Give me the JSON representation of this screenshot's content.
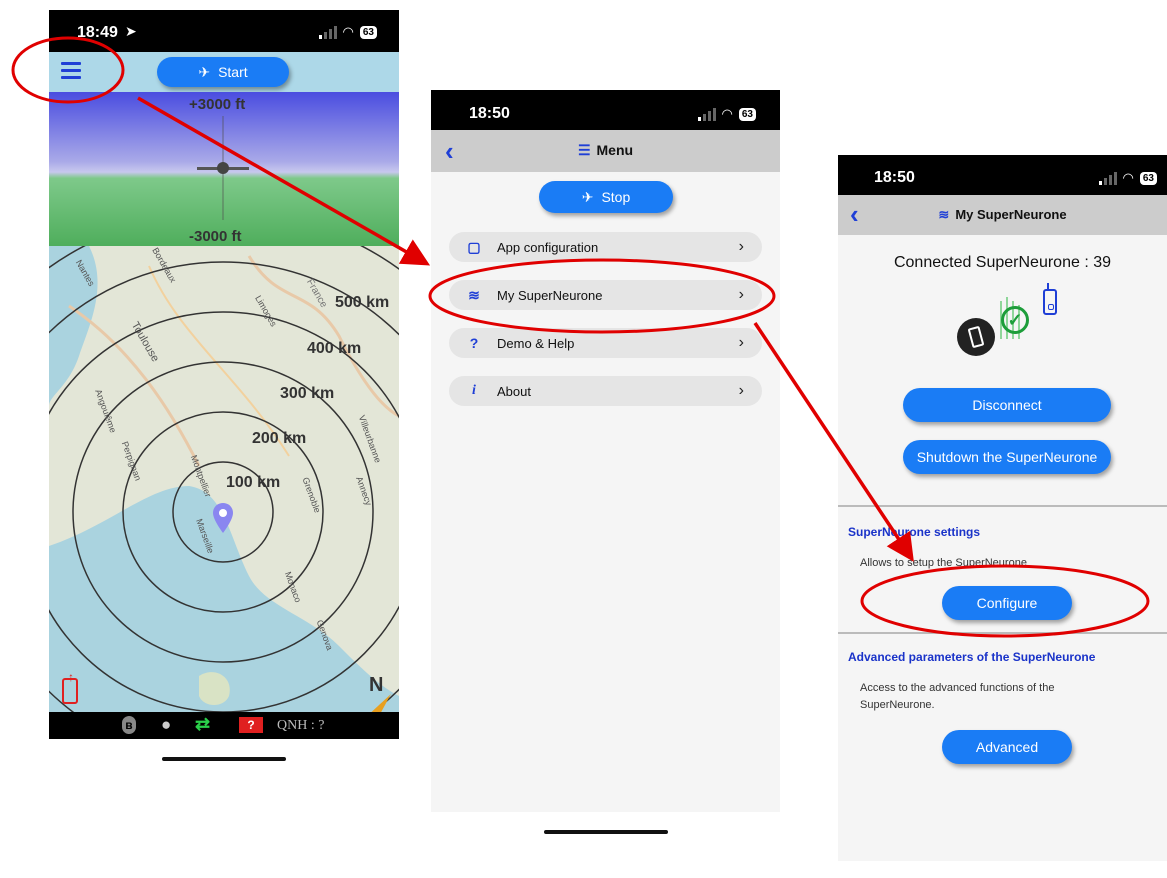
{
  "phone1": {
    "status_time": "18:49",
    "battery": "63",
    "start_label": "Start",
    "altitude_top": "+3000 ft",
    "altitude_bottom": "-3000 ft",
    "ring_labels": [
      "500 km",
      "400 km",
      "300 km",
      "200 km",
      "100 km"
    ],
    "qnh": "QNH : ?",
    "map_towns": [
      "Toulouse",
      "Angoulême",
      "Perpignan",
      "Montpellier",
      "Marseille",
      "Limoges",
      "France",
      "Villeurbanne",
      "Annecy",
      "Grenoble",
      "Monaco",
      "Genova",
      "Bordeaux",
      "Nantes"
    ]
  },
  "phone2": {
    "status_time": "18:50",
    "battery": "63",
    "title": "Menu",
    "stop_label": "Stop",
    "items": [
      {
        "icon": "tablet-icon",
        "label": "App configuration"
      },
      {
        "icon": "wifi-icon",
        "label": "My SuperNeurone"
      },
      {
        "icon": "question-icon",
        "label": "Demo & Help"
      },
      {
        "icon": "info-icon",
        "label": "About"
      }
    ]
  },
  "phone3": {
    "status_time": "18:50",
    "battery": "63",
    "title": "My SuperNeurone",
    "connected_text": "Connected SuperNeurone : 39",
    "disconnect_label": "Disconnect",
    "shutdown_label": "Shutdown the SuperNeurone",
    "settings_title": "SuperNeurone settings",
    "settings_desc": "Allows to setup the SuperNeurone",
    "configure_label": "Configure",
    "advanced_title": "Advanced parameters of the SuperNeurone",
    "advanced_desc_1": "Access to the advanced functions of the",
    "advanced_desc_2": "SuperNeurone.",
    "advanced_label": "Advanced"
  },
  "colors": {
    "accent_blue": "#1a7cf5",
    "annotation_red": "#e00000",
    "title_blue": "#1a33c9"
  }
}
